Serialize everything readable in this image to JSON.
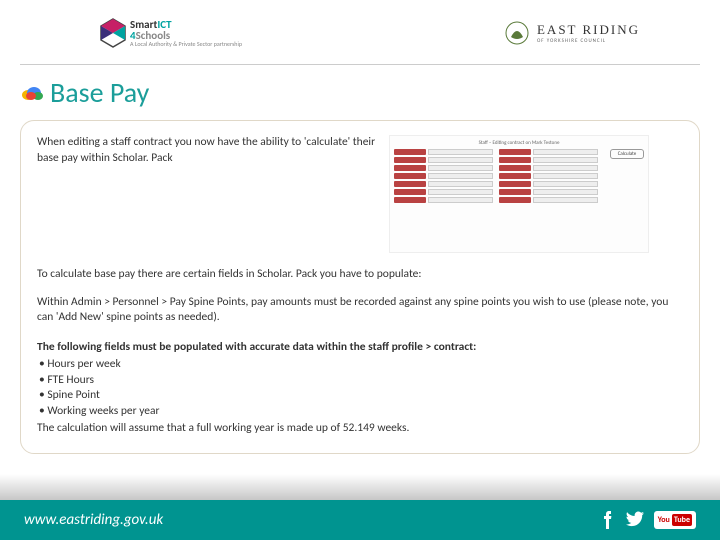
{
  "header": {
    "left_logo": {
      "line1_a": "Smart",
      "line1_b": "ICT",
      "line2_a": "4",
      "line2_b": "Schools",
      "tagline": "A Local Authority & Private Sector partnership"
    },
    "right_logo": {
      "line1": "EAST RIDING",
      "line2": "OF YORKSHIRE COUNCIL"
    }
  },
  "title": "Base Pay",
  "content": {
    "intro": "When editing a staff contract you now have the ability to 'calculate' their base pay within Scholar. Pack",
    "thumb_button": "Calculate",
    "thumb_title": "Staff – Editing contract on Mark Testone",
    "para_populate": "To calculate base pay there are certain fields in Scholar. Pack you have to populate:",
    "para_spine": "Within Admin > Personnel > Pay Spine Points, pay amounts must be recorded against any spine points you wish to use (please note, you can 'Add New' spine points as needed).",
    "list_intro": "The following fields must be populated with accurate data within the staff profile > contract:",
    "fields": [
      "Hours per week",
      "FTE Hours",
      "Spine Point",
      "Working weeks per year"
    ],
    "calc_note": "The calculation will assume that a full working year is made up of 52.149 weeks."
  },
  "footer": {
    "url": "www.eastriding.gov.uk",
    "youtube": "YouTube"
  }
}
